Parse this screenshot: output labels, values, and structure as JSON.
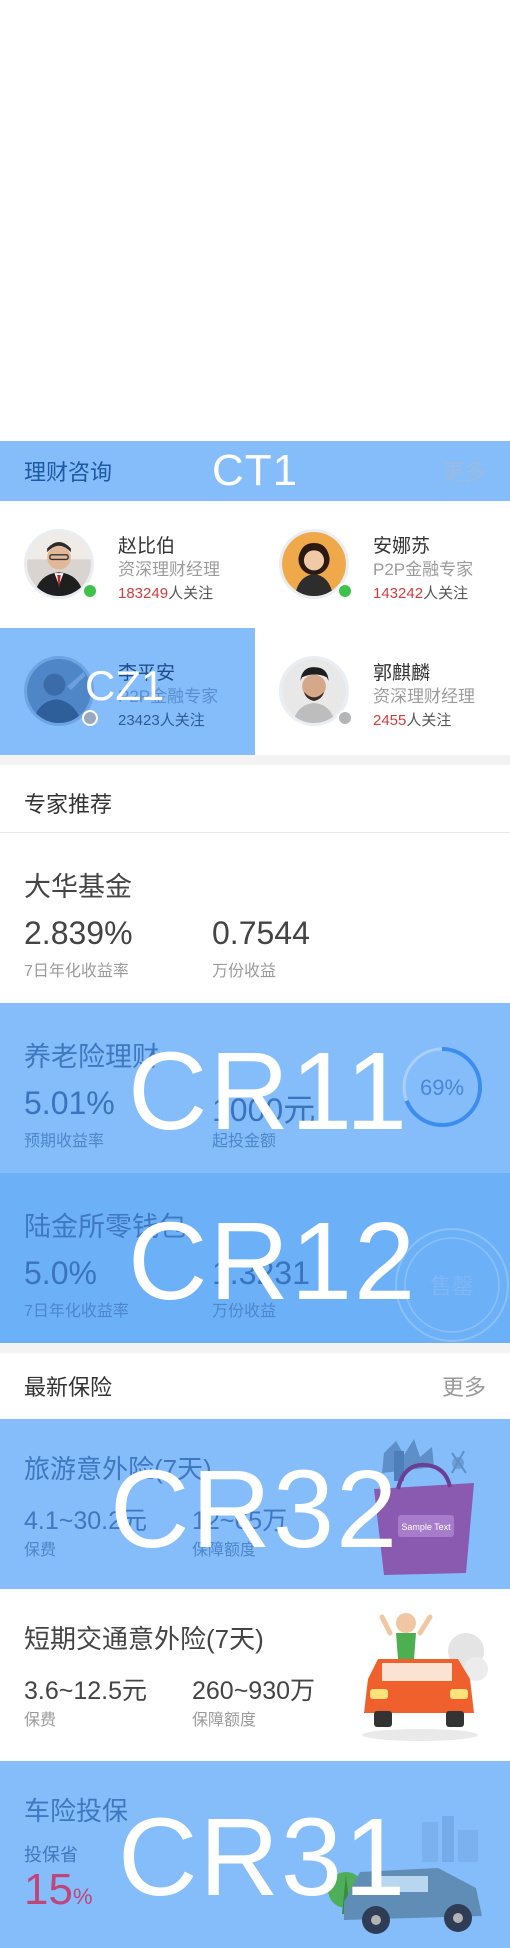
{
  "consult": {
    "title": "理财咨询",
    "more": "更多",
    "overlay": "CT1",
    "advisors": [
      {
        "name": "赵比伯",
        "role": "资深理财经理",
        "followers": "183249",
        "suffix": "人关注",
        "status_color": "#3fc24a"
      },
      {
        "name": "安娜苏",
        "role": "P2P金融专家",
        "followers": "143242",
        "suffix": "人关注",
        "status_color": "#3fc24a"
      },
      {
        "name": "李平安",
        "role": "P2P金融专家",
        "followers": "23423",
        "suffix": "人关注",
        "status_color": "#9aa9bd",
        "overlay": "CZ1"
      },
      {
        "name": "郭麒麟",
        "role": "资深理财经理",
        "followers": "2455",
        "suffix": "人关注",
        "status_color": "#b5b5b5"
      }
    ]
  },
  "experts": {
    "title": "专家推荐"
  },
  "funds": [
    {
      "name": "大华基金",
      "value1": "2.839%",
      "label1": "7日年化收益率",
      "value2": "0.7544",
      "label2": "万份收益"
    },
    {
      "name": "养老险理财",
      "value1": "5.01%",
      "label1": "预期收益率",
      "value2": "1000元",
      "label2": "起投金额",
      "overlay": "CR11",
      "gauge": "69%",
      "progress": 0.69
    },
    {
      "name": "陆金所零钱包",
      "value1": "5.0%",
      "label1": "7日年化收益率",
      "value2": "1.3231",
      "label2": "万份收益",
      "overlay": "CR12",
      "stamp": "售罄"
    }
  ],
  "insurance": {
    "title": "最新保险",
    "more": "更多",
    "items": [
      {
        "name": "旅游意外险(7天)",
        "value1": "4.1~30.2元",
        "label1": "保费",
        "value2": "12~65万",
        "label2": "保障额度",
        "overlay": "CR32",
        "bag_text": "Sample Text"
      },
      {
        "name": "短期交通意外险(7天)",
        "value1": "3.6~12.5元",
        "label1": "保费",
        "value2": "260~930万",
        "label2": "保障额度"
      }
    ]
  },
  "car": {
    "name": "车险投保",
    "sub": "投保省",
    "pct": "15",
    "pct_unit": "%",
    "overlay": "CR31"
  },
  "colors": {
    "overlay_blue": "#84bdf9",
    "deep_blue": "#6cb0f7",
    "red_number": "#d23c3c",
    "online_green": "#3fc24a"
  }
}
